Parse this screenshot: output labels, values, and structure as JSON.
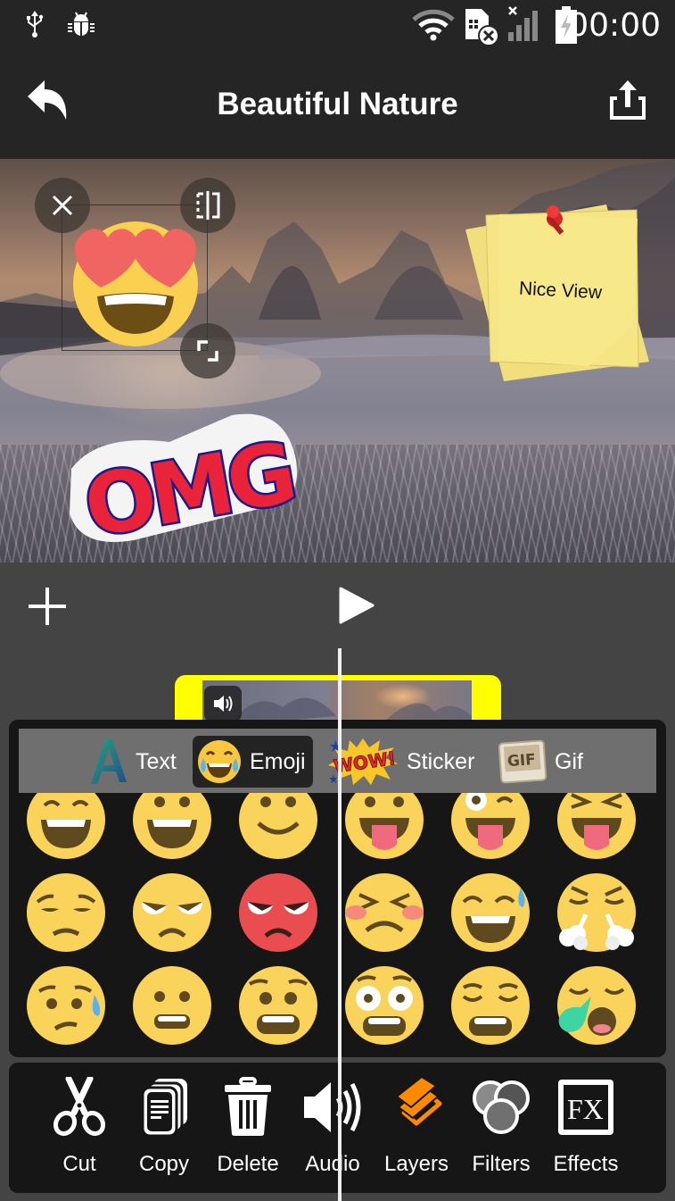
{
  "status_bar": {
    "left_icons": [
      "usb-icon",
      "debug-bug-icon"
    ],
    "right_icons": [
      "wifi-icon",
      "sim-missing-icon",
      "signal-no-service-icon",
      "battery-charging-icon"
    ],
    "time": "00:00"
  },
  "app_bar": {
    "title": "Beautiful Nature",
    "back_icon": "reply-arrow-icon",
    "share_icon": "share-upload-icon"
  },
  "preview": {
    "stickers": [
      {
        "type": "emoji",
        "name": "heart-eyes-emoji",
        "selected": true
      },
      {
        "type": "sticker",
        "name": "sticky-note",
        "text": "Nice View"
      },
      {
        "type": "sticker",
        "name": "omg-sticker",
        "text": "OMG"
      }
    ],
    "selection_controls": [
      "delete-icon",
      "flip-icon",
      "resize-icon"
    ]
  },
  "playback": {
    "add_icon": "plus-icon",
    "play_icon": "play-icon"
  },
  "timeline": {
    "clip_audio_icon": "volume-icon",
    "clip_color": "#ffff00"
  },
  "sticker_panel": {
    "tabs": [
      {
        "label": "Text",
        "icon": "letter-a-icon",
        "active": false
      },
      {
        "label": "Emoji",
        "icon": "laughing-emoji-icon",
        "active": true
      },
      {
        "label": "Sticker",
        "icon": "wow-sticker-icon",
        "active": false
      },
      {
        "label": "Gif",
        "icon": "gif-icon",
        "active": false
      }
    ],
    "emojis": [
      "grinning-squinting-face",
      "grinning-face",
      "slightly-smiling-face",
      "face-with-tongue",
      "winking-face-with-tongue",
      "squinting-face-with-tongue",
      "disappointed-face",
      "unamused-angry-face",
      "pouting-face",
      "confounded-blushing-face",
      "grinning-face-with-sweat",
      "face-with-steam",
      "sad-relieved-face",
      "grimacing-face",
      "anxious-grimacing-face",
      "astonished-face",
      "weary-face",
      "sleepy-yawning-face"
    ]
  },
  "toolbar": {
    "items": [
      {
        "label": "Cut",
        "icon": "scissors-icon",
        "active": false
      },
      {
        "label": "Copy",
        "icon": "copy-icon",
        "active": false
      },
      {
        "label": "Delete",
        "icon": "trash-icon",
        "active": false
      },
      {
        "label": "Audio",
        "icon": "speaker-icon",
        "active": false
      },
      {
        "label": "Layers",
        "icon": "layers-icon",
        "active": true
      },
      {
        "label": "Filters",
        "icon": "filters-icon",
        "active": false
      },
      {
        "label": "Effects",
        "icon": "fx-icon",
        "active": false
      }
    ],
    "active_color": "#ff8a00"
  }
}
